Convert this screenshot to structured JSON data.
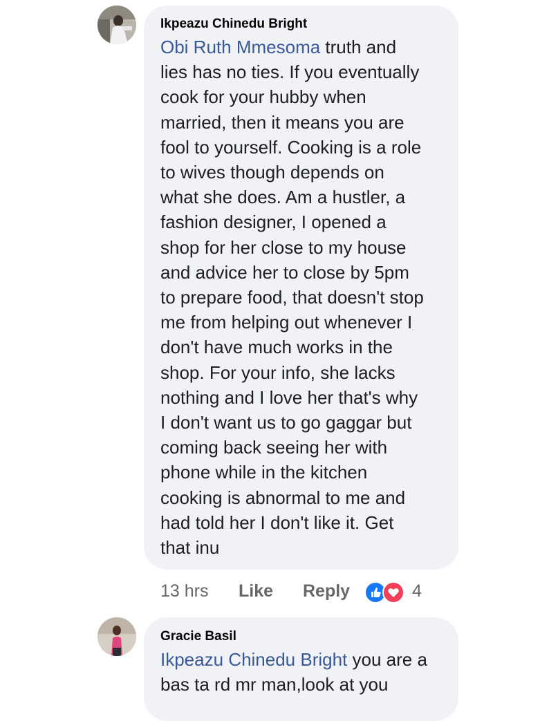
{
  "comments": [
    {
      "author": "Ikpeazu Chinedu Bright",
      "mention": "Obi Ruth Mmesoma",
      "first_line_rest": " truth and",
      "lines": [
        "lies has no ties. If you eventually",
        "cook for your hubby when",
        "married, then it means you are",
        "fool to yourself. Cooking is a role",
        "to wives though depends on",
        "what she does. Am a hustler, a",
        "fashion designer, I opened a",
        "shop for her close to my house",
        "and advice her to close by 5pm",
        "to prepare food, that doesn't stop",
        "me from helping out whenever I",
        "don't have much works in the",
        "shop. For your info, she lacks",
        "nothing and I love her that's why",
        "I don't want us to go gaggar but",
        "coming back seeing her with",
        "phone while in the kitchen",
        "cooking is abnormal to me and",
        "had told her I don't like it. Get",
        "that inu"
      ],
      "time": "13 hrs",
      "like_label": "Like",
      "reply_label": "Reply",
      "reaction_count": "4",
      "reactions": [
        "like-icon",
        "love-icon"
      ]
    },
    {
      "author": "Gracie Basil",
      "mention": "Ikpeazu Chinedu Bright",
      "first_line_rest": " you are a",
      "lines": [
        "bas ta rd mr man,look at you"
      ]
    }
  ],
  "colors": {
    "bubble": "#f0f2f5",
    "mention": "#385898",
    "meta": "#65676b",
    "like_blue": "#1877f2",
    "love_red": "#f33e58"
  }
}
